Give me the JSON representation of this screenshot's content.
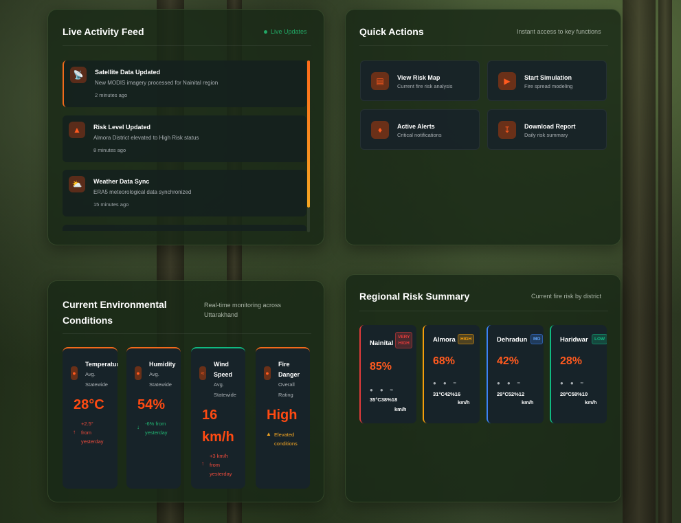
{
  "feed": {
    "title": "Live Activity Feed",
    "live_label": "Live Updates",
    "items": [
      {
        "icon": "satellite-icon",
        "title": "Satellite Data Updated",
        "desc": "New MODIS imagery processed for Nainital region",
        "time": "2 minutes ago"
      },
      {
        "icon": "warning-icon",
        "title": "Risk Level Updated",
        "desc": "Almora District elevated to High Risk status",
        "time": "8 minutes ago"
      },
      {
        "icon": "weather-icon",
        "title": "Weather Data Sync",
        "desc": "ERA5 meteorological data synchronized",
        "time": "15 minutes ago"
      }
    ]
  },
  "quick": {
    "title": "Quick Actions",
    "subtitle": "Instant access to key functions",
    "actions": [
      {
        "icon": "chart-icon",
        "label": "View Risk Map",
        "desc": "Current fire risk analysis"
      },
      {
        "icon": "play-icon",
        "label": "Start Simulation",
        "desc": "Fire spread modeling"
      },
      {
        "icon": "bell-icon",
        "label": "Active Alerts",
        "desc": "Critical notifications"
      },
      {
        "icon": "download-icon",
        "label": "Download Report",
        "desc": "Daily risk summary"
      }
    ]
  },
  "env": {
    "title_line1": "Current Environmental",
    "title_line2": "Conditions",
    "subtitle_line1": "Real-time monitoring across",
    "subtitle_line2": "Uttarakhand",
    "cards": [
      {
        "icon": "thermometer-icon",
        "name": "Temperature",
        "sub1": "Avg.",
        "sub2": "Statewide",
        "value": "28°C",
        "chg1": "+2.5°",
        "chg2": "from",
        "chg3": "yesterday"
      },
      {
        "icon": "droplet-icon",
        "name": "Humidity",
        "sub1": "Avg.",
        "sub2": "Statewide",
        "value": "54%",
        "chg1": "-6% from",
        "chg2": "yesterday"
      },
      {
        "icon": "wind-icon",
        "name1": "Wind",
        "name2": "Speed",
        "sub1": "Avg.",
        "sub2": "Statewide",
        "value1": "16",
        "value2": "km/h",
        "chg1": "+3 km/h",
        "chg2": "from",
        "chg3": "yesterday"
      },
      {
        "icon": "fire-icon",
        "name1": "Fire",
        "name2": "Danger",
        "sub1": "Overall",
        "sub2": "Rating",
        "value": "High",
        "chg1": "Elevated",
        "chg2": "conditions"
      }
    ],
    "colors": {
      "up": "#ef4b3c",
      "down": "#22b573",
      "warn": "#f5a623"
    }
  },
  "regional": {
    "title": "Regional Risk Summary",
    "subtitle": "Current fire risk by district",
    "districts": [
      {
        "name": "Nainital",
        "badge1": "VERY",
        "badge2": "HIGH",
        "pct": "85%",
        "stats": "35°C38%18",
        "unit": "km/h",
        "color": "#e23b3b"
      },
      {
        "name": "Almora",
        "badge1": "HIGH",
        "pct": "68%",
        "stats": "31°C42%16",
        "unit": "km/h",
        "color": "#f59e0b"
      },
      {
        "name": "Dehradun",
        "badge1": "MO",
        "pct": "42%",
        "stats": "29°C52%12",
        "unit": "km/h",
        "color": "#3b82f6"
      },
      {
        "name": "Haridwar",
        "badge1": "LOW",
        "pct": "28%",
        "stats": "28°C58%10",
        "unit": "km/h",
        "color": "#10b981"
      }
    ]
  }
}
